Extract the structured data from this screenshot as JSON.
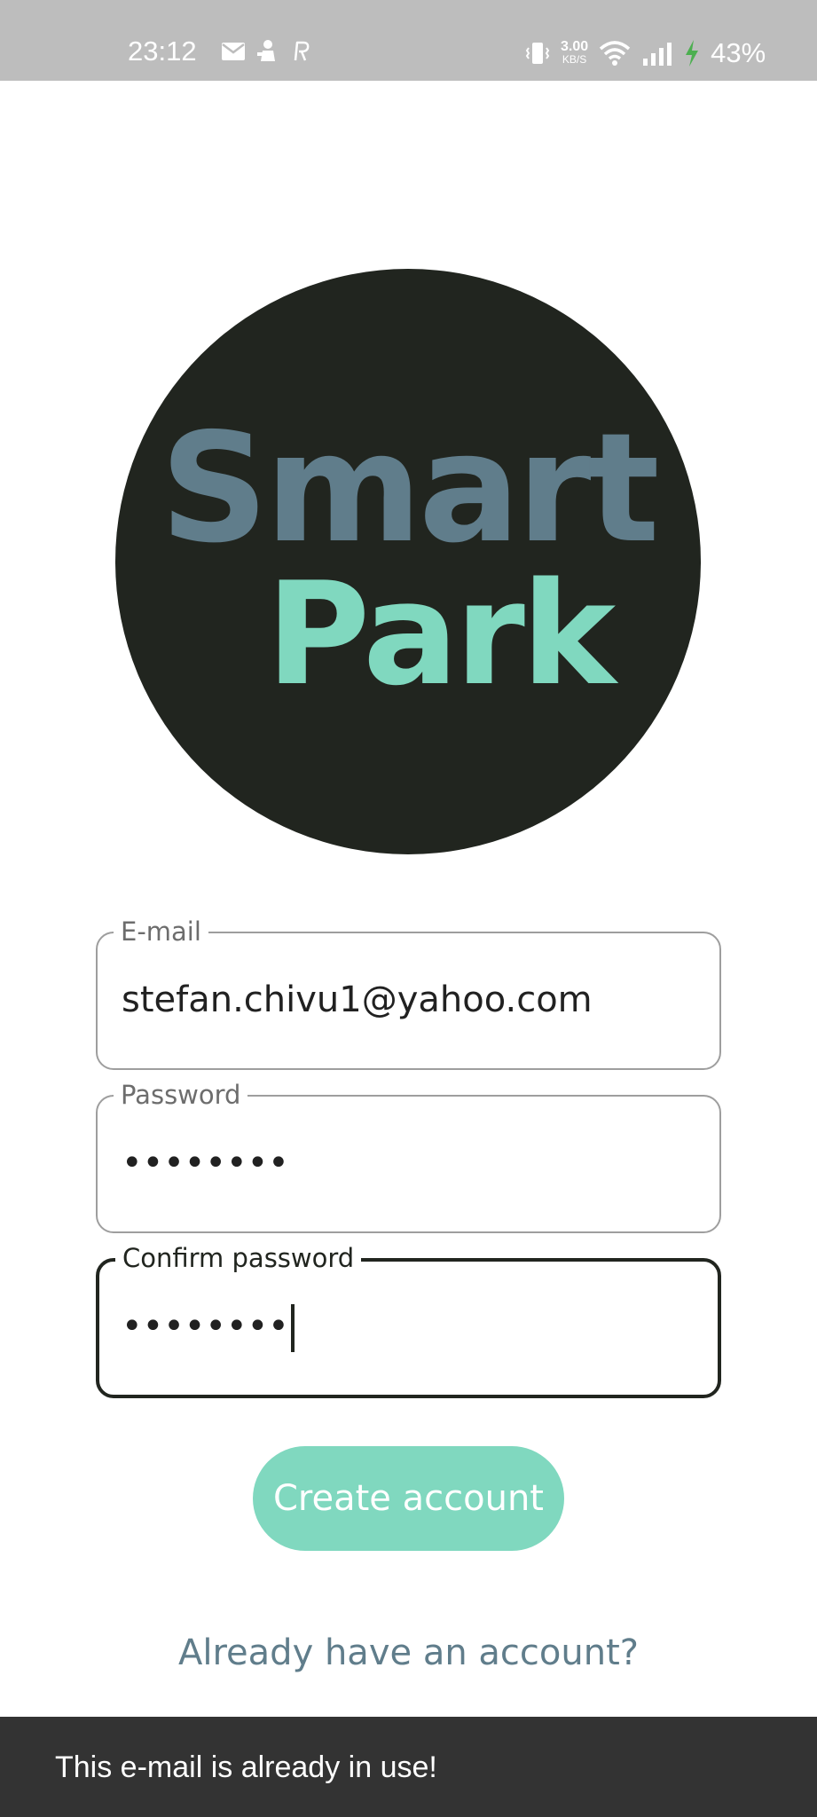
{
  "status_bar": {
    "time": "23:12",
    "net_speed_value": "3.00",
    "net_speed_unit": "KB/S",
    "battery": "43%",
    "icons": [
      "mail-icon",
      "notification-app-icon",
      "r-app-icon",
      "vibrate-icon",
      "wifi-icon",
      "signal-icon",
      "charging-icon"
    ],
    "charging_color": "#4caf50"
  },
  "logo": {
    "line1": "Smart",
    "line2": "Park",
    "bg_color": "#21251f",
    "line1_color": "#607d8b",
    "line2_color": "#80d8bf"
  },
  "form": {
    "email": {
      "label": "E-mail",
      "value": "stefan.chivu1@yahoo.com"
    },
    "password": {
      "label": "Password",
      "value": "••••••••"
    },
    "confirm_password": {
      "label": "Confirm password",
      "value": "••••••••"
    }
  },
  "create_button": {
    "label": "Create account",
    "color": "#80d8bf"
  },
  "login_link": {
    "label": "Already have an account?",
    "color": "#607d8b"
  },
  "snackbar": {
    "message": "This e-mail is already in use!"
  }
}
